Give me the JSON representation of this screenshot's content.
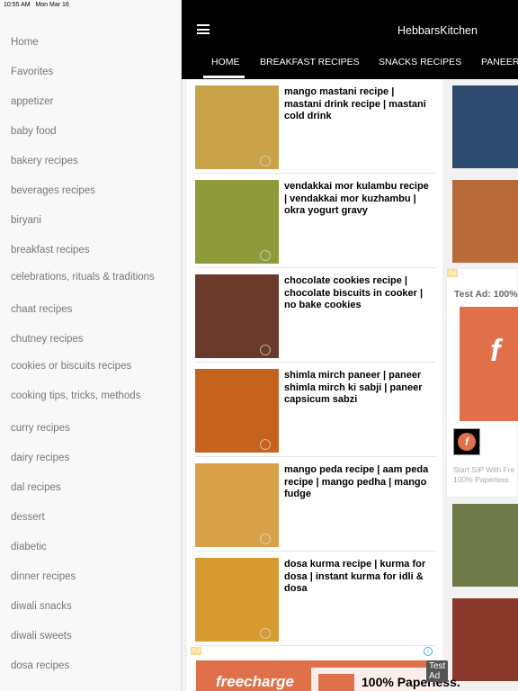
{
  "status": {
    "time": "10:55 AM",
    "date": "Mon Mar 16"
  },
  "sidebar": {
    "items": [
      "Home",
      "Favorites",
      "appetizer",
      "baby food",
      "bakery recipes",
      "beverages recipes",
      "biryani",
      "breakfast recipes",
      "celebrations, rituals & traditions",
      "chaat recipes",
      "chutney recipes",
      "cookies or biscuits recipes",
      "cooking tips, tricks, methods",
      "curry recipes",
      "dairy recipes",
      "dal recipes",
      "dessert",
      "diabetic",
      "dinner recipes",
      "diwali snacks",
      "diwali sweets",
      "dosa recipes"
    ]
  },
  "header": {
    "title": "HebbarsKitchen",
    "tabs": [
      "HOME",
      "BREAKFAST RECIPES",
      "SNACKS RECIPES",
      "PANEER"
    ]
  },
  "recipes": [
    {
      "title": "mango mastani recipe | mastani drink recipe | mastani cold drink",
      "color": "#c9a24a"
    },
    {
      "title": "vendakkai mor kulambu recipe | vendakkai mor kuzhambu | okra yogurt gravy",
      "color": "#8f9a3a"
    },
    {
      "title": "chocolate cookies recipe | chocolate biscuits in cooker | no bake cookies",
      "color": "#6b3a2a"
    },
    {
      "title": "shimla mirch paneer | paneer shimla mirch ki sabji | paneer capsicum sabzi",
      "color": "#c4621e"
    },
    {
      "title": "mango peda recipe | aam peda recipe | mango pedha | mango fudge",
      "color": "#d9a24a"
    },
    {
      "title": "dosa kurma recipe | kurma for dosa | instant kurma for idli & dosa",
      "color": "#d69a30"
    }
  ],
  "right_ad": {
    "badge": "Ad",
    "headline": "Test Ad: 100%",
    "body": "Start SIP With Fre 100% Paperless",
    "brand_color": "#e0704a"
  },
  "bottom_ad": {
    "badge": "Ad",
    "tooltip": "Test Ad",
    "brand": "freecharge",
    "headline": "100% Paperless.",
    "brand_color": "#e0704a"
  }
}
